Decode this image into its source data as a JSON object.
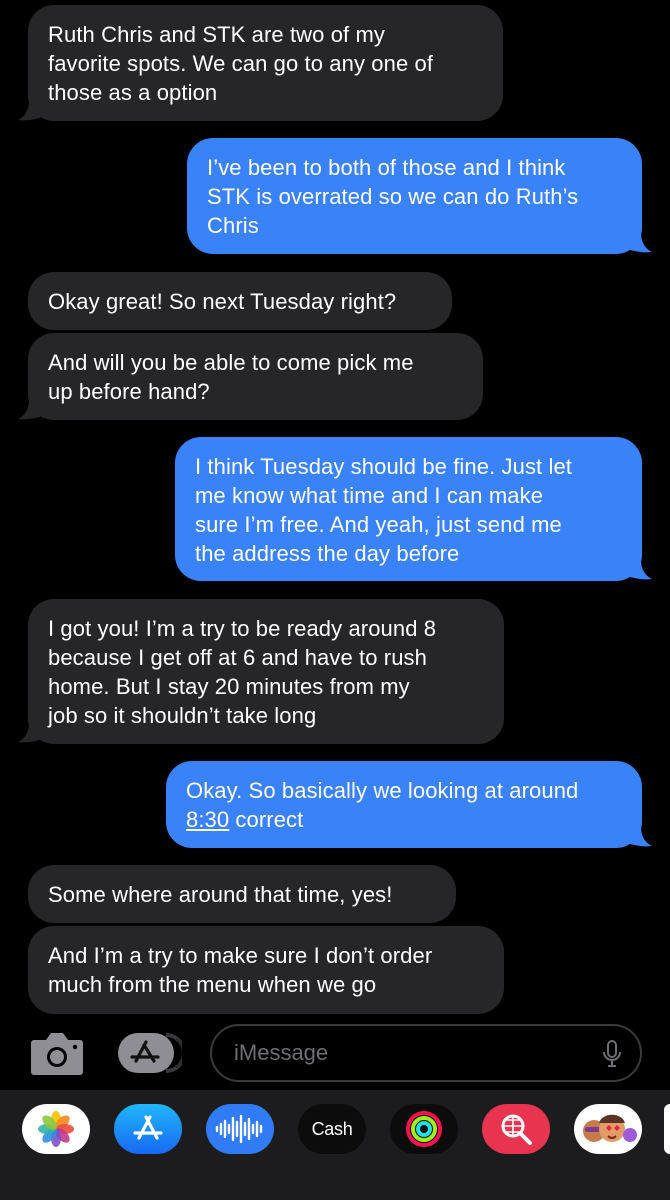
{
  "messages": [
    {
      "dir": "in",
      "text": "Ruth Chris and STK are two of my\nfavorite spots. We can go to any one of\nthose as a option"
    },
    {
      "dir": "out",
      "text": "I’ve been to both of those and I think\nSTK is overrated so we can do Ruth’s\nChris"
    },
    {
      "dir": "in",
      "text": "Okay great! So next Tuesday right?"
    },
    {
      "dir": "in",
      "text": "And will you be able to come pick me\nup before hand?"
    },
    {
      "dir": "out",
      "text": "I think Tuesday should be fine. Just let\nme know what time and I can make\nsure I’m free. And yeah, just send me\nthe address the day before"
    },
    {
      "dir": "in",
      "text": "I got you! I’m a try to be ready around 8\nbecause I get off at 6 and have to rush\nhome. But I stay 20 minutes from my\njob so it shouldn’t take long"
    },
    {
      "dir": "out",
      "text_before": "Okay. So basically we looking at around\n",
      "link": "8:30",
      "text_after": " correct"
    },
    {
      "dir": "in",
      "text": "Some where around that time, yes!"
    },
    {
      "dir": "in",
      "text": "And I’m a try to make sure I don’t order\nmuch from the menu when we go"
    }
  ],
  "input": {
    "placeholder": "iMessage"
  },
  "app_drawer": {
    "cash_label": "Cash",
    "apple_glyph": ""
  },
  "colors": {
    "incoming": "#262628",
    "outgoing": "#3a82f7",
    "background": "#000000",
    "drawer": "#1c1c1e"
  }
}
